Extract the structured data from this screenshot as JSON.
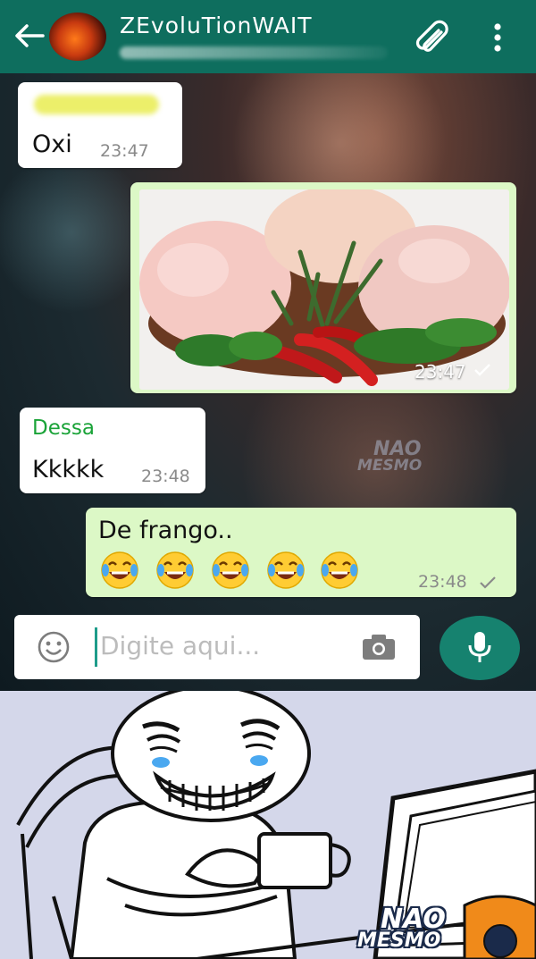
{
  "header": {
    "contact_name": "ZEvoluTionWAIT",
    "back_icon": "arrow-left-icon",
    "attach_icon": "paperclip-icon",
    "menu_icon": "more-vertical-icon",
    "bar_color": "#0e6e5e"
  },
  "messages": [
    {
      "direction": "incoming",
      "text": "Oxi",
      "time": "23:47"
    },
    {
      "direction": "outgoing",
      "type": "image",
      "time": "23:47",
      "status": "sent-check-icon"
    },
    {
      "direction": "incoming",
      "sender": "Dessa",
      "text": "Kkkkk",
      "time": "23:48"
    },
    {
      "direction": "outgoing",
      "text": "De frango..",
      "emoji": "joy-emoji-icon",
      "emoji_count": 5,
      "time": "23:48",
      "status": "sent-check-icon"
    }
  ],
  "composer": {
    "placeholder": "Digite aqui...",
    "emoji_icon": "smiley-icon",
    "camera_icon": "camera-icon",
    "mic_icon": "microphone-icon",
    "accent": "#16826f"
  },
  "watermark": {
    "line1": "NAO",
    "line2": "MESMO"
  },
  "colors": {
    "incoming_bubble": "#ffffff",
    "outgoing_bubble": "#dcf8c6",
    "sender_name": "#1aa338"
  }
}
